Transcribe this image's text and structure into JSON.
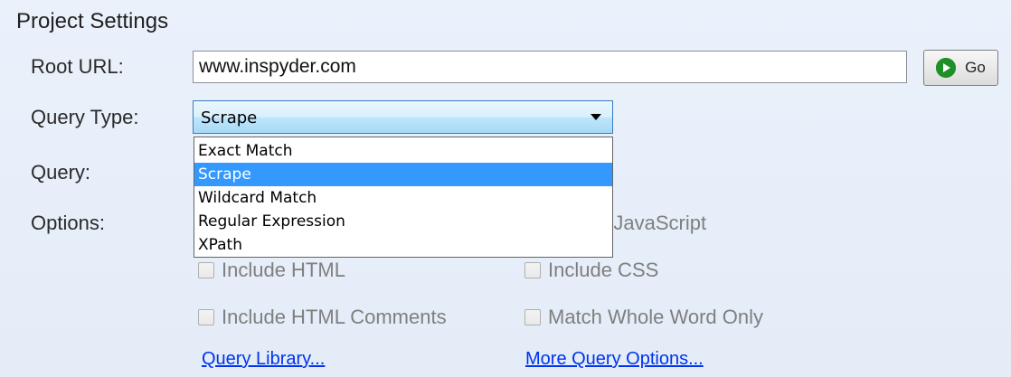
{
  "section": {
    "title": "Project Settings"
  },
  "root_url": {
    "label": "Root URL:",
    "value": "www.inspyder.com"
  },
  "go_button": {
    "label": "Go",
    "icon": "play-circle-icon",
    "color": "#1f8f2a"
  },
  "query_type": {
    "label": "Query Type:",
    "selected": "Scrape",
    "options": [
      "Exact Match",
      "Scrape",
      "Wildcard Match",
      "Regular Expression",
      "XPath"
    ],
    "highlight_color": "#3399ff"
  },
  "query": {
    "label": "Query:"
  },
  "options": {
    "label": "Options:",
    "partial_visible_text": "e JavaScript",
    "checkboxes": [
      {
        "label": "Include HTML",
        "checked": false,
        "enabled": false
      },
      {
        "label": "Include CSS",
        "checked": false,
        "enabled": false
      },
      {
        "label": "Include HTML Comments",
        "checked": false,
        "enabled": false
      },
      {
        "label": "Match Whole Word Only",
        "checked": false,
        "enabled": false
      }
    ]
  },
  "links": {
    "query_library": "Query Library...",
    "more_query_options": "More Query Options..."
  }
}
